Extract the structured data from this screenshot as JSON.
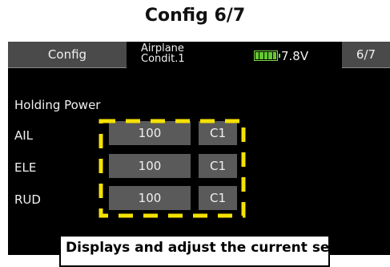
{
  "page_title": "Config 6/7",
  "header": {
    "tab_label": "Config",
    "model_name": "Airplane",
    "condition": "Condit.1",
    "battery_icon": "battery-icon",
    "battery_color": "#64c832",
    "voltage": "7.8V",
    "page_indicator": "6/7"
  },
  "section": {
    "heading": "Holding Power",
    "rows": [
      {
        "label": "AIL",
        "value": "100",
        "mode": "C1"
      },
      {
        "label": "ELE",
        "value": "100",
        "mode": "C1"
      },
      {
        "label": "RUD",
        "value": "100",
        "mode": "C1"
      }
    ]
  },
  "highlight_color": "#f5e100",
  "callout_text": "Displays and adjust the current set"
}
